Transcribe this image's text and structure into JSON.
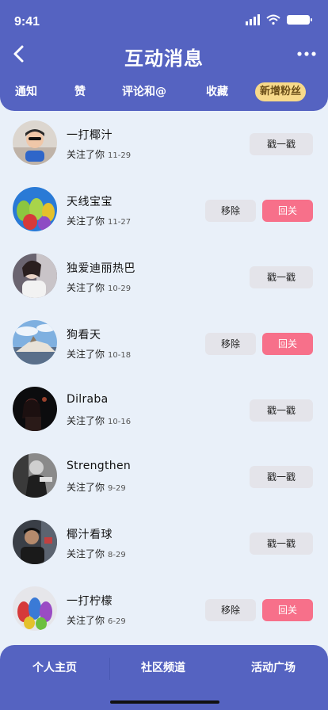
{
  "status_bar": {
    "time": "9:41"
  },
  "nav": {
    "title": "互动消息"
  },
  "tabs": [
    {
      "label": "通知"
    },
    {
      "label": "赞"
    },
    {
      "label": "评论和@"
    },
    {
      "label": "收藏"
    },
    {
      "label": "新增粉丝",
      "active": true
    }
  ],
  "colors": {
    "header": "#5563c1",
    "active_tab": "#f7d98a",
    "follow_back": "#f7708a",
    "neutral_button": "#e4e4ea",
    "page_bg": "#e9f0f9"
  },
  "followers": [
    {
      "name": "一打椰汁",
      "action": "关注了你",
      "date": "11-29",
      "buttons": [
        "戳一戳"
      ]
    },
    {
      "name": "天线宝宝",
      "action": "关注了你",
      "date": "11-27",
      "buttons": [
        "移除",
        "回关"
      ]
    },
    {
      "name": "独爱迪丽热巴",
      "action": "关注了你",
      "date": "10-29",
      "buttons": [
        "戳一戳"
      ]
    },
    {
      "name": "狗看天",
      "action": "关注了你",
      "date": "10-18",
      "buttons": [
        "移除",
        "回关"
      ]
    },
    {
      "name": "Dilraba",
      "action": "关注了你",
      "date": "10-16",
      "buttons": [
        "戳一戳"
      ]
    },
    {
      "name": "Strengthen",
      "action": "关注了你",
      "date": "9-29",
      "buttons": [
        "戳一戳"
      ]
    },
    {
      "name": "椰汁看球",
      "action": "关注了你",
      "date": "8-29",
      "buttons": [
        "戳一戳"
      ]
    },
    {
      "name": "一打柠檬",
      "action": "关注了你",
      "date": "6-29",
      "buttons": [
        "移除",
        "回关"
      ]
    }
  ],
  "bottom_nav": [
    {
      "label": "个人主页"
    },
    {
      "label": "社区频道"
    },
    {
      "label": "活动广场"
    }
  ],
  "icons": [
    "back-arrow-icon",
    "more-icon",
    "signal-icon",
    "wifi-icon",
    "battery-icon"
  ]
}
